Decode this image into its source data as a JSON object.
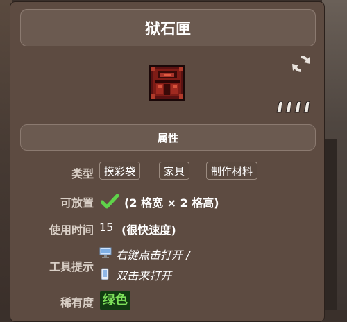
{
  "title": "狱石匣",
  "section": "属性",
  "rows": {
    "type_label": "类型",
    "placeable_label": "可放置",
    "usetime_label": "使用时间",
    "tooltip_label": "工具提示",
    "rarity_label": "稀有度"
  },
  "type_tags": [
    "摸彩袋",
    "家具",
    "制作材料"
  ],
  "placeable": {
    "value": "(2 格宽 × 2 格高)"
  },
  "usetime": {
    "number": "15",
    "desc": "(很快速度)"
  },
  "tooltip": {
    "line1": "右键点击打开 /",
    "line2": "双击来打开"
  },
  "rarity": {
    "value": "绿色",
    "color": "#7ee25a"
  },
  "colors": {
    "panel": "#5d4b41",
    "header": "#6b5a50",
    "label": "#d9cfc6",
    "check": "#5fd34a"
  }
}
